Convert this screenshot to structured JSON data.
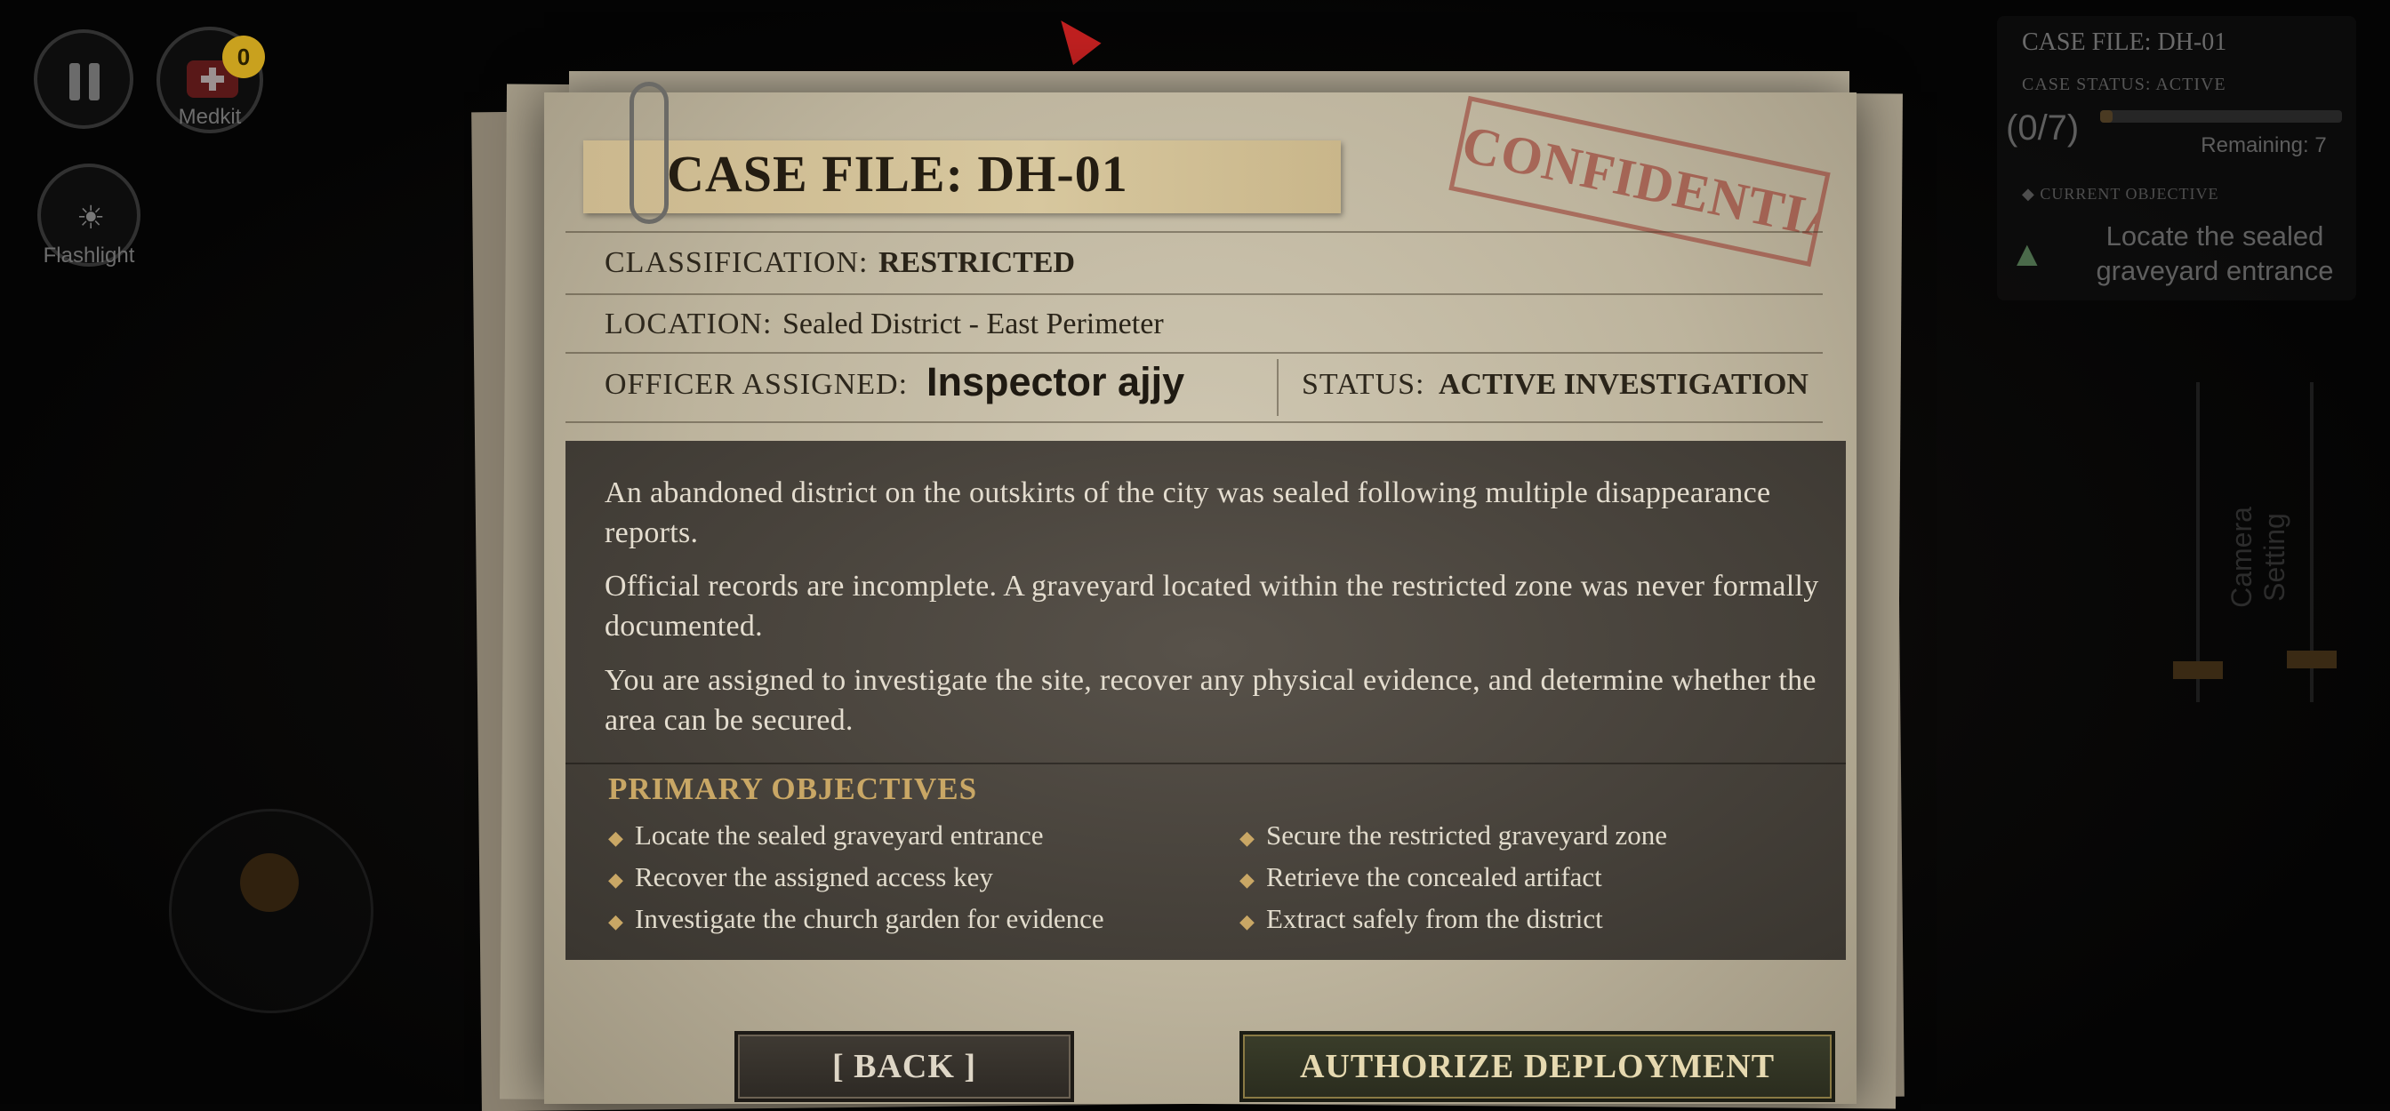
{
  "hud": {
    "medkit": {
      "label": "Medkit",
      "count": "0"
    },
    "flashlight": {
      "label": "Flashlight"
    },
    "pause_icon": "pause-icon"
  },
  "case_panel": {
    "title": "CASE FILE: DH-01",
    "status": "CASE STATUS: ACTIVE",
    "progress": "(0/7)",
    "progress_fraction": 0.05,
    "remaining": "Remaining: 7",
    "objective_header": "CURRENT OBJECTIVE",
    "objective_text": "Locate the sealed graveyard entrance"
  },
  "camera_setting": {
    "label": "Camera Setting"
  },
  "dossier": {
    "title": "CASE FILE: DH-01",
    "stamp": "CONFIDENTIAL",
    "classification_label": "CLASSIFICATION:",
    "classification_value": "RESTRICTED",
    "location_label": "LOCATION:",
    "location_value": "Sealed District - East Perimeter",
    "officer_label": "OFFICER ASSIGNED:",
    "officer_value": "Inspector ajjy",
    "status_label": "STATUS:",
    "status_value": "ACTIVE INVESTIGATION",
    "paragraphs": [
      "An abandoned district on the outskirts of the city was sealed following multiple disappearance reports.",
      "Official records are incomplete. A graveyard located within the restricted zone was never formally documented.",
      "You are assigned to investigate the site, recover any physical evidence, and determine whether the area can be secured."
    ],
    "objectives_header": "PRIMARY OBJECTIVES",
    "objectives": [
      "Locate the sealed graveyard entrance",
      "Recover the assigned access key",
      "Investigate the church garden for evidence",
      "Secure the restricted graveyard zone",
      "Retrieve the concealed artifact",
      "Extract safely from the district"
    ]
  },
  "buttons": {
    "back": "[ BACK ]",
    "deploy": "AUTHORIZE DEPLOYMENT"
  },
  "colors": {
    "accent_gold": "#c9a765",
    "stamp_red": "#963228",
    "medkit_badge": "#c9a11e"
  }
}
